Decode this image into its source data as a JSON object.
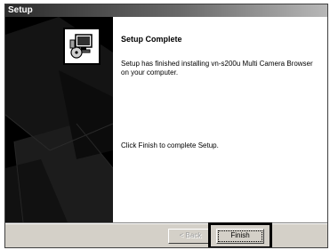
{
  "window": {
    "title": "Setup"
  },
  "sidebar": {
    "icon": "computer-setup-icon"
  },
  "content": {
    "heading": "Setup Complete",
    "message": "Setup has finished installing vn-s200u Multi Camera Browser on your computer.",
    "finish_note": "Click Finish to complete Setup."
  },
  "buttons": {
    "back_label": "< Back",
    "finish_label": "Finish"
  },
  "colors": {
    "dialog_background": "#d4d0c8",
    "panel_background": "#000000",
    "content_background": "#ffffff"
  }
}
